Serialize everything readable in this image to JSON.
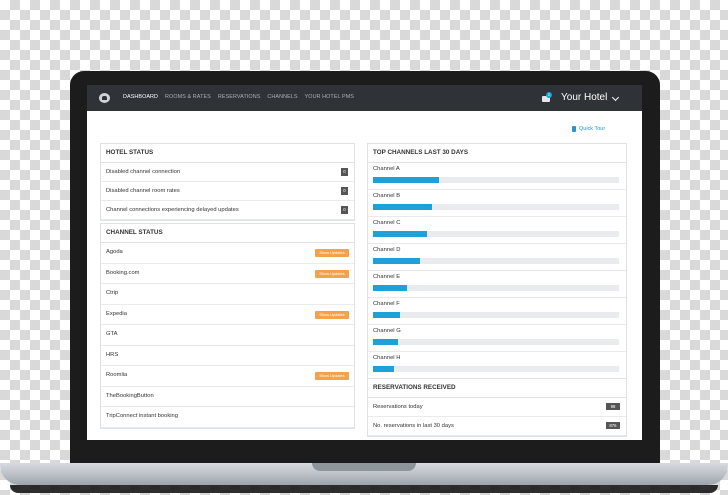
{
  "nav": {
    "items": [
      "DASHBOARD",
      "ROOMS & RATES",
      "RESERVATIONS",
      "CHANNELS",
      "YOUR HOTEL PMS"
    ],
    "active_index": 0,
    "notification_count": "2",
    "hotel_label": "Your Hotel"
  },
  "quick_tour": "Quick Tour",
  "hotel_status": {
    "title": "HOTEL STATUS",
    "rows": [
      {
        "label": "Disabled channel connection",
        "count": "0"
      },
      {
        "label": "Disabled channel room rates",
        "count": "0"
      },
      {
        "label": "Channel connections experiencing delayed updates",
        "count": "0"
      }
    ]
  },
  "channel_status": {
    "title": "CHANNEL STATUS",
    "button_label": "Show Updates",
    "rows": [
      {
        "label": "Agoda",
        "has_updates": true
      },
      {
        "label": "Booking.com",
        "has_updates": true
      },
      {
        "label": "Ctrip",
        "has_updates": false
      },
      {
        "label": "Expedia",
        "has_updates": true
      },
      {
        "label": "GTA",
        "has_updates": false
      },
      {
        "label": "HRS",
        "has_updates": false
      },
      {
        "label": "Roomlia",
        "has_updates": true
      },
      {
        "label": "TheBookingButton",
        "has_updates": false
      },
      {
        "label": "TripConnect instant booking",
        "has_updates": false
      }
    ]
  },
  "top_channels": {
    "title": "TOP CHANNELS LAST 30 DAYS",
    "channels": [
      {
        "name": "Channel A",
        "share": 0.27
      },
      {
        "name": "Channel B",
        "share": 0.24
      },
      {
        "name": "Channel C",
        "share": 0.22
      },
      {
        "name": "Channel D",
        "share": 0.19
      },
      {
        "name": "Channel E",
        "share": 0.14
      },
      {
        "name": "Channel F",
        "share": 0.11
      },
      {
        "name": "Channel G",
        "share": 0.1
      },
      {
        "name": "Channel H",
        "share": 0.085
      }
    ],
    "bar_color": "#1ea0d8"
  },
  "reservations": {
    "title": "RESERVATIONS RECEIVED",
    "rows": [
      {
        "label": "Reservations today",
        "count": "98"
      },
      {
        "label": "No. reservations in last 30 days",
        "count": "876"
      }
    ]
  }
}
